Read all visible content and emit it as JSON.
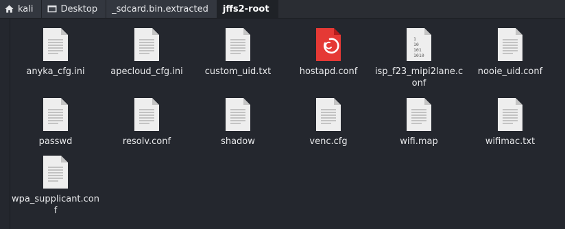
{
  "breadcrumbs": [
    {
      "label": "kali",
      "icon": "home-icon"
    },
    {
      "label": "Desktop",
      "icon": "desktop-icon"
    },
    {
      "label": "_sdcard.bin.extracted"
    },
    {
      "label": "jffs2-root",
      "active": true
    }
  ],
  "files": [
    {
      "name": "anyka_cfg.ini",
      "icon": "text-file-icon"
    },
    {
      "name": "apecloud_cfg.ini",
      "icon": "text-file-icon"
    },
    {
      "name": "custom_uid.txt",
      "icon": "text-file-icon"
    },
    {
      "name": "hostapd.conf",
      "icon": "debian-package-icon"
    },
    {
      "name": "isp_f23_mipi2lane.conf",
      "icon": "binary-file-icon"
    },
    {
      "name": "nooie_uid.conf",
      "icon": "text-file-icon"
    },
    {
      "name": "passwd",
      "icon": "text-file-icon"
    },
    {
      "name": "resolv.conf",
      "icon": "text-file-icon"
    },
    {
      "name": "shadow",
      "icon": "text-file-icon"
    },
    {
      "name": "venc.cfg",
      "icon": "text-file-icon"
    },
    {
      "name": "wifi.map",
      "icon": "text-file-icon"
    },
    {
      "name": "wifimac.txt",
      "icon": "text-file-icon"
    },
    {
      "name": "wpa_supplicant.conf",
      "icon": "text-file-icon"
    }
  ],
  "binary_icon_text": [
    "1",
    "10",
    "101",
    "1010"
  ],
  "colors": {
    "accent": "#e53935",
    "background": "#24272e"
  }
}
